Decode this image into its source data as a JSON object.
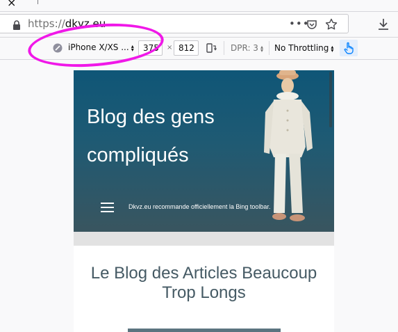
{
  "browser": {
    "tab_close": "×",
    "url_prefix": "https://",
    "url_host": "dkvz.eu",
    "page_actions": "•••"
  },
  "rdm": {
    "device": "iPhone X/XS ...",
    "width": "375",
    "times": "×",
    "height": "812",
    "dpr": "DPR: 3",
    "throttling": "No Throttling",
    "select_arrows": "▲▼"
  },
  "page": {
    "blog_title": "Blog des gens compliqués",
    "tagline": "Dkvz.eu recommande officiellement la Bing toolbar.",
    "post_title": "Le Blog des Articles Beaucoup Trop Longs"
  },
  "colors": {
    "annotation": "#f018e8",
    "header_top": "#0f5677",
    "header_bottom": "#39555f",
    "post_title": "#455a64"
  }
}
